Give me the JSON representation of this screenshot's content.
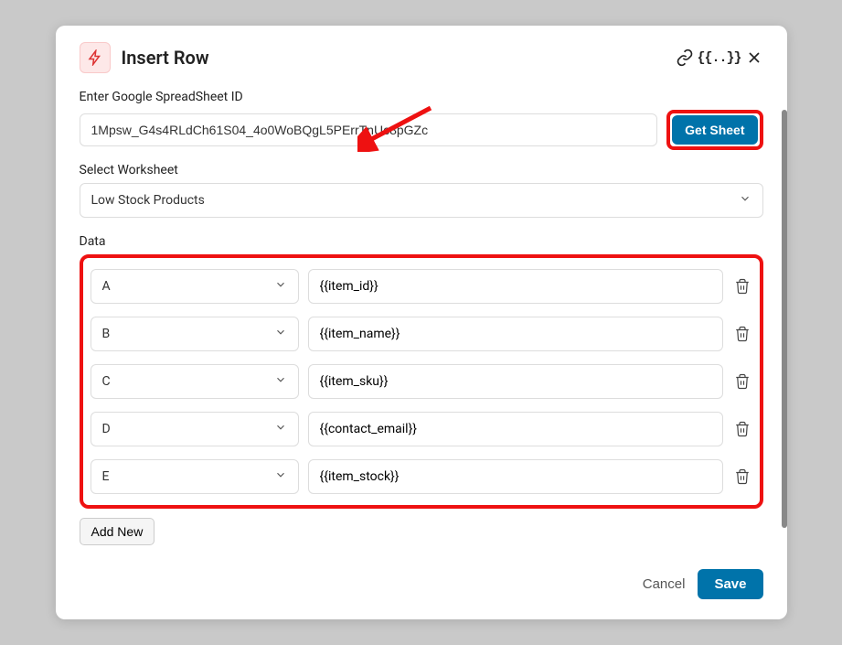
{
  "dialog": {
    "title": "Insert Row",
    "spreadsheet_label": "Enter Google SpreadSheet ID",
    "spreadsheet_value": "1Mpsw_G4s4RLdCh61S04_4o0WoBQgL5PErrTnUc8pGZc",
    "get_sheet_label": "Get Sheet",
    "worksheet_label": "Select Worksheet",
    "worksheet_value": "Low Stock Products",
    "data_label": "Data",
    "rows": [
      {
        "col": "A",
        "val": "{{item_id}}"
      },
      {
        "col": "B",
        "val": "{{item_name}}"
      },
      {
        "col": "C",
        "val": "{{item_sku}}"
      },
      {
        "col": "D",
        "val": "{{contact_email}}"
      },
      {
        "col": "E",
        "val": "{{item_stock}}"
      }
    ],
    "add_new_label": "Add New",
    "cancel_label": "Cancel",
    "save_label": "Save"
  }
}
